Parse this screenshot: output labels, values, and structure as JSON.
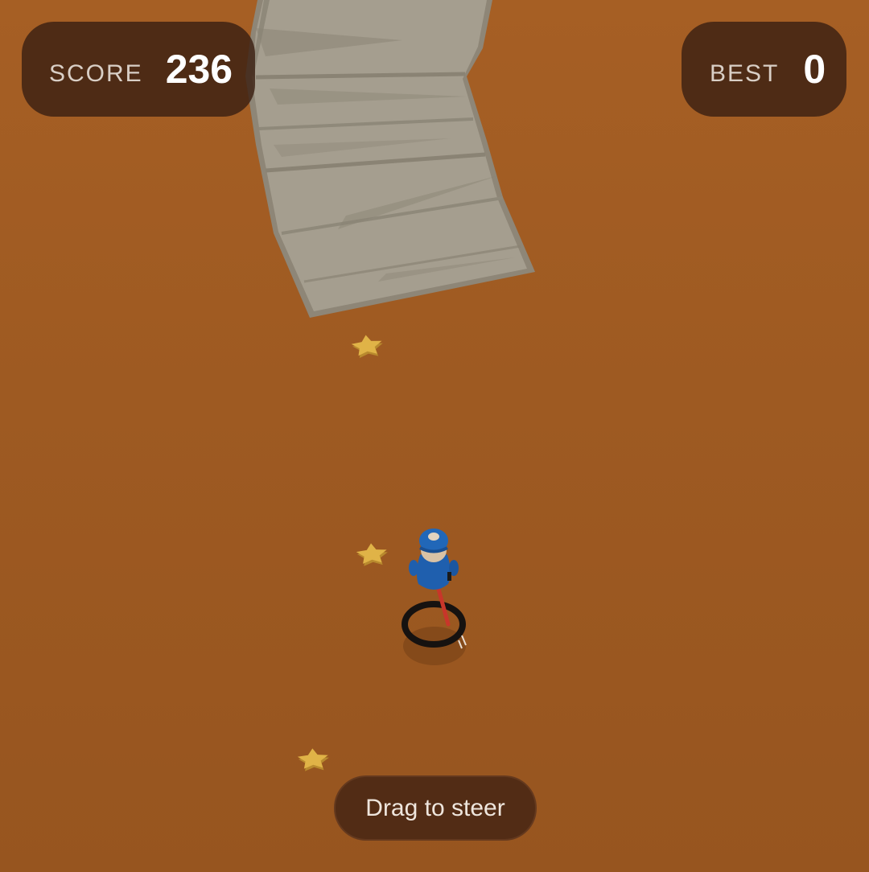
{
  "hud": {
    "score_label": "SCORE",
    "score_value": "236",
    "best_label": "BEST",
    "best_value": "0"
  },
  "hint": {
    "text": "Drag to steer"
  },
  "scene": {
    "ground_color": "#a05c22",
    "road_color": "#9c9585",
    "star_color": "#e0b347",
    "character_color": "#1f5fae",
    "tire_color": "#161210",
    "stick_color": "#c8362a",
    "icons": [
      "star-pickup-icon",
      "character-icon",
      "tire-icon"
    ]
  }
}
